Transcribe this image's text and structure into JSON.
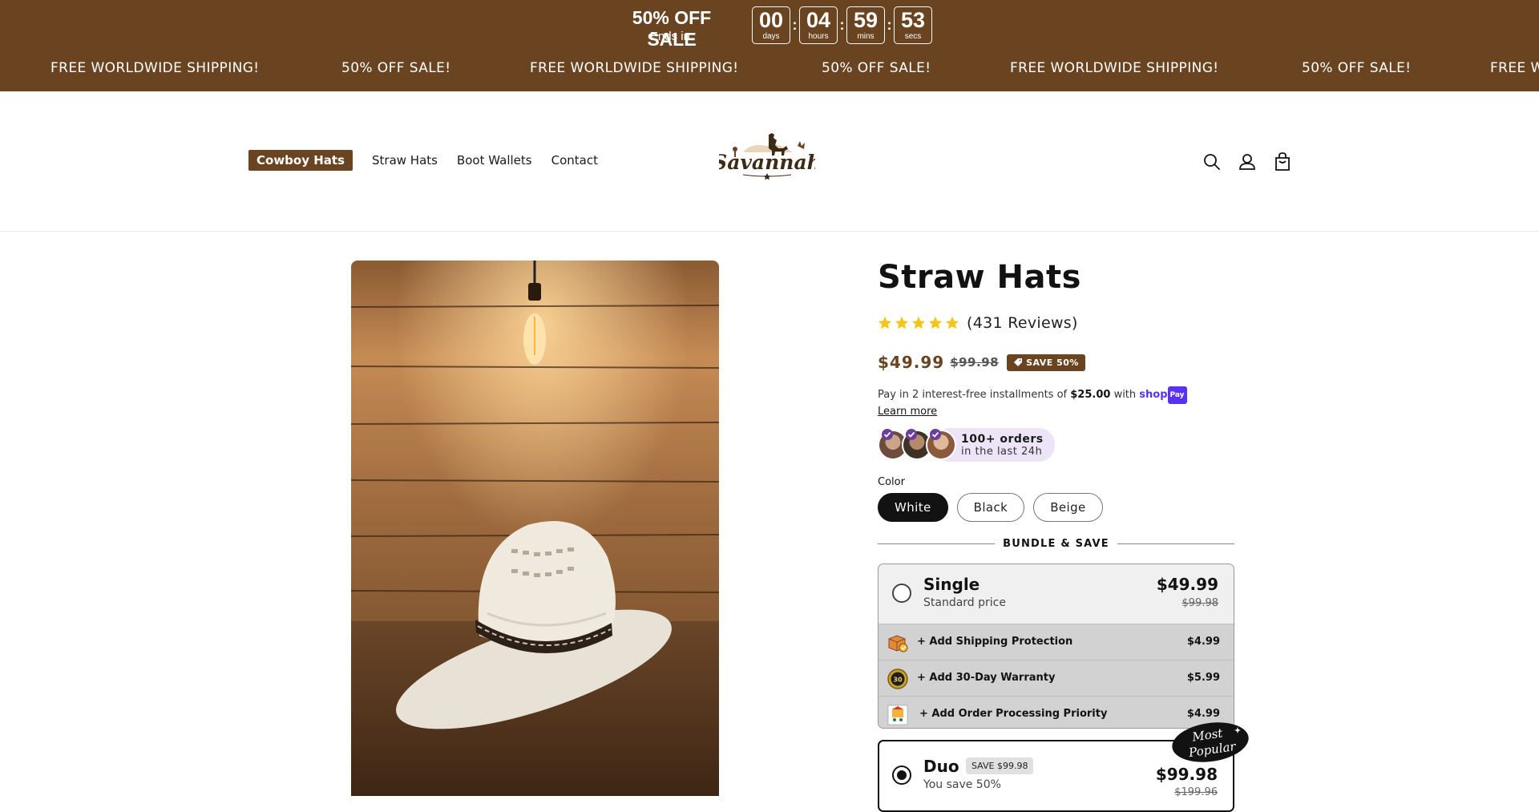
{
  "announcement": {
    "sale_title": "50% OFF SALE",
    "ends_in": "Ends in:",
    "timer": [
      {
        "value": "00",
        "label": "days"
      },
      {
        "value": "04",
        "label": "hours"
      },
      {
        "value": "59",
        "label": "mins"
      },
      {
        "value": "53",
        "label": "secs"
      }
    ],
    "marquee": [
      "FREE WORLDWIDE SHIPPING!",
      "50% OFF SALE!",
      "FREE WORLDWIDE SHIPPING!",
      "50% OFF SALE!",
      "FREE WORLDWIDE SHIPPING!",
      "50% OFF SALE!",
      "FREE W"
    ]
  },
  "nav": {
    "items": [
      "Cowboy Hats",
      "Straw Hats",
      "Boot Wallets",
      "Contact"
    ],
    "logo_text": "Savannah",
    "icons": [
      "search-icon",
      "account-icon",
      "cart-icon"
    ]
  },
  "product": {
    "title": "Straw Hats",
    "reviews": "(431 Reviews)",
    "price": "$49.99",
    "compare_price": "$99.98",
    "save_badge": "SAVE 50%",
    "installments_prefix": "Pay in 2 interest-free installments of",
    "installments_amount": "$25.00",
    "installments_with": "with",
    "shop_logo": "shop",
    "shop_pay": "Pay",
    "learn_more": "Learn more",
    "orders_title": "100+ orders",
    "orders_sub": "in the last 24h",
    "color_label": "Color",
    "colors": [
      "White",
      "Black",
      "Beige"
    ],
    "selected_color": "White"
  },
  "bundle": {
    "heading": "BUNDLE & SAVE",
    "single": {
      "name": "Single",
      "sub": "Standard price",
      "price": "$49.99",
      "compare": "$99.98",
      "addons": [
        {
          "label": "+ Add Shipping Protection",
          "price": "$4.99"
        },
        {
          "label": "+ Add 30-Day Warranty",
          "price": "$5.99"
        },
        {
          "label": "+ Add Order Processing Priority",
          "price": "$4.99"
        }
      ]
    },
    "duo": {
      "name": "Duo",
      "badge": "SAVE $99.98",
      "sub": "You save 50%",
      "price": "$99.98",
      "compare": "$199.96",
      "ribbon_line1": "Most",
      "ribbon_line2": "Popular"
    }
  },
  "colors": {
    "brand": "#6a4421",
    "accent_purple": "#5a31f4",
    "star": "#f5c518"
  }
}
